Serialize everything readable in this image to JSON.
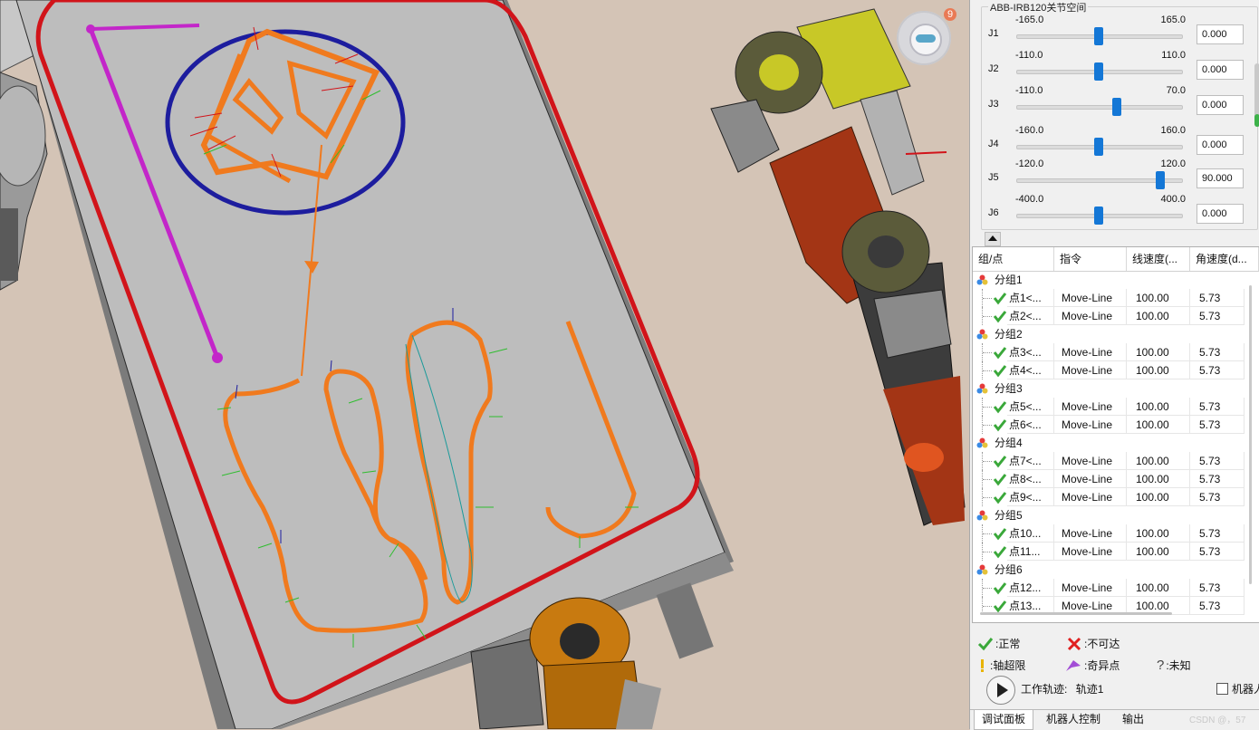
{
  "badge": {
    "count": "9",
    "icon": "robot-assistant-icon"
  },
  "joint_panel": {
    "title": "ABB-IRB120关节空间",
    "joints": [
      {
        "name": "J1",
        "min": "-165.0",
        "max": "165.0",
        "value": "0.000",
        "pos": 0.5
      },
      {
        "name": "J2",
        "min": "-110.0",
        "max": "110.0",
        "value": "0.000",
        "pos": 0.5
      },
      {
        "name": "J3",
        "min": "-110.0",
        "max": "70.0",
        "value": "0.000",
        "pos": 0.611
      },
      {
        "name": "J4",
        "min": "-160.0",
        "max": "160.0",
        "value": "0.000",
        "pos": 0.5
      },
      {
        "name": "J5",
        "min": "-120.0",
        "max": "120.0",
        "value": "90.000",
        "pos": 0.875
      },
      {
        "name": "J6",
        "min": "-400.0",
        "max": "400.0",
        "value": "0.000",
        "pos": 0.5
      }
    ]
  },
  "grid": {
    "columns": [
      "组/点",
      "指令",
      "线速度(...",
      "角速度(d..."
    ],
    "rows": [
      {
        "type": "group",
        "name": "分组1"
      },
      {
        "type": "point",
        "name": "点1<...",
        "cmd": "Move-Line",
        "lin": "100.00",
        "ang": "5.73"
      },
      {
        "type": "point",
        "name": "点2<...",
        "cmd": "Move-Line",
        "lin": "100.00",
        "ang": "5.73"
      },
      {
        "type": "group",
        "name": "分组2"
      },
      {
        "type": "point",
        "name": "点3<...",
        "cmd": "Move-Line",
        "lin": "100.00",
        "ang": "5.73"
      },
      {
        "type": "point",
        "name": "点4<...",
        "cmd": "Move-Line",
        "lin": "100.00",
        "ang": "5.73"
      },
      {
        "type": "group",
        "name": "分组3"
      },
      {
        "type": "point",
        "name": "点5<...",
        "cmd": "Move-Line",
        "lin": "100.00",
        "ang": "5.73"
      },
      {
        "type": "point",
        "name": "点6<...",
        "cmd": "Move-Line",
        "lin": "100.00",
        "ang": "5.73"
      },
      {
        "type": "group",
        "name": "分组4"
      },
      {
        "type": "point",
        "name": "点7<...",
        "cmd": "Move-Line",
        "lin": "100.00",
        "ang": "5.73"
      },
      {
        "type": "point",
        "name": "点8<...",
        "cmd": "Move-Line",
        "lin": "100.00",
        "ang": "5.73"
      },
      {
        "type": "point",
        "name": "点9<...",
        "cmd": "Move-Line",
        "lin": "100.00",
        "ang": "5.73"
      },
      {
        "type": "group",
        "name": "分组5"
      },
      {
        "type": "point",
        "name": "点10...",
        "cmd": "Move-Line",
        "lin": "100.00",
        "ang": "5.73"
      },
      {
        "type": "point",
        "name": "点11...",
        "cmd": "Move-Line",
        "lin": "100.00",
        "ang": "5.73"
      },
      {
        "type": "group",
        "name": "分组6"
      },
      {
        "type": "point",
        "name": "点12...",
        "cmd": "Move-Line",
        "lin": "100.00",
        "ang": "5.73"
      },
      {
        "type": "point",
        "name": "点13...",
        "cmd": "Move-Line",
        "lin": "100.00",
        "ang": "5.73"
      }
    ]
  },
  "legend": {
    "normal": ":正常",
    "unreachable": ":不可达",
    "axis_limit": ":轴超限",
    "singular": ":奇异点",
    "unknown": ":未知",
    "work_track_label": "工作轨迹:",
    "work_track_value": "轨迹1",
    "robot_checkbox": "机器人"
  },
  "tabs": [
    "调试面板",
    "机器人控制",
    "输出"
  ],
  "watermark": "CSDN @，57",
  "colors": {
    "accent": "#1477d6",
    "path_orange": "#f07a1e",
    "boundary_red": "#d3141b",
    "circle_blue": "#1d1d9e",
    "magenta": "#c326c9",
    "ok_green": "#3aa83a"
  }
}
